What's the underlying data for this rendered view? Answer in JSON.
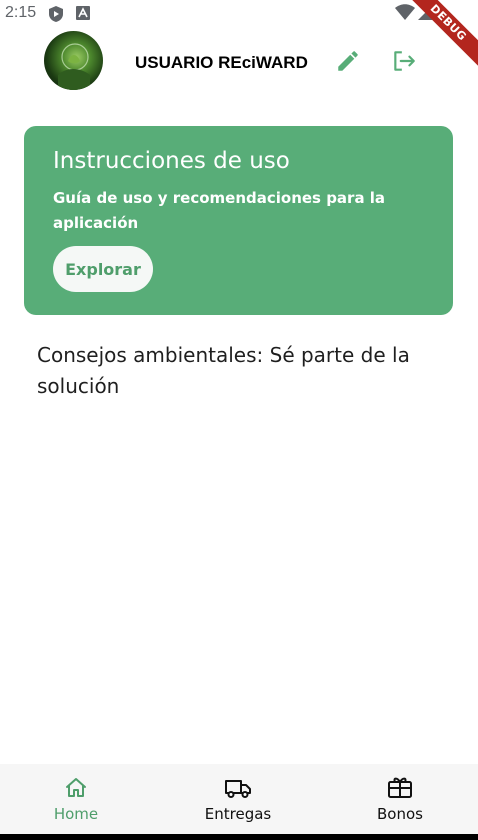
{
  "status_bar": {
    "time": "2:15",
    "debug_label": "DEBUG"
  },
  "header": {
    "user_name": "USUARIO REciWARD"
  },
  "card": {
    "title": "Instrucciones de uso",
    "subtitle": "Guía de uso y recomendaciones para la aplicación",
    "button_label": "Explorar"
  },
  "tips_heading": "Consejos ambientales: Sé parte de la solución",
  "bottom_nav": {
    "items": [
      {
        "label": "Home",
        "icon": "home-icon",
        "active": true
      },
      {
        "label": "Entregas",
        "icon": "truck-icon",
        "active": false
      },
      {
        "label": "Bonos",
        "icon": "card-giftcard-icon",
        "active": false
      }
    ]
  },
  "colors": {
    "accent": "#58ad78",
    "accent_text": "#4f9e6b"
  }
}
